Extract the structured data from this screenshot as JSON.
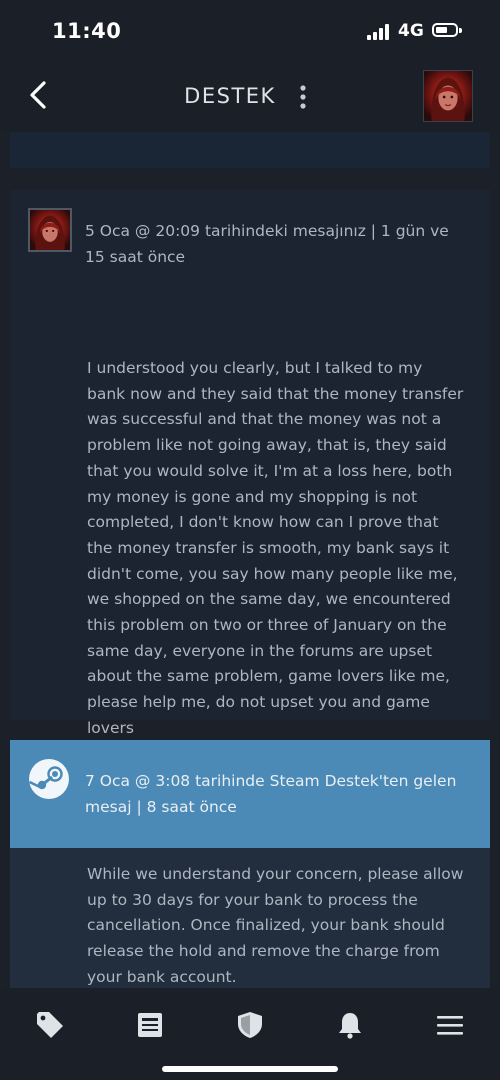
{
  "status": {
    "time": "11:40",
    "network": "4G"
  },
  "header": {
    "title": "DESTEK"
  },
  "messages": [
    {
      "meta": "5 Oca @ 20:09 tarihindeki mesajınız | 1 gün ve 15 saat önce",
      "body": "I understood you clearly, but I talked to my bank now and they said that the money transfer was successful and that the money was not a problem like not going away, that is, they said that you would solve it, I'm at a loss here, both my money is gone and my shopping is not completed, I don't know how can I prove that the money transfer is smooth, my bank says it didn't come, you say how many people like me, we shopped on the same day, we encountered this problem on two or three of January on the same day, everyone in the forums are upset about the same problem, game lovers like me, please help me, do not upset you and game lovers"
    },
    {
      "meta": "7 Oca @ 3:08 tarihinde Steam Destek'ten gelen mesaj | 8 saat önce",
      "body": "While we understand your concern, please allow up to 30 days for your bank to process the cancellation. Once finalized, your bank should release the hold and remove the charge from your bank account."
    }
  ],
  "nav": {
    "icons": [
      "tag-icon",
      "news-icon",
      "shield-icon",
      "bell-icon",
      "menu-icon"
    ]
  },
  "colors": {
    "background": "#1c2129",
    "card": "#1b2430",
    "support_header": "#4b8ab7",
    "support_body": "#222e3e"
  }
}
